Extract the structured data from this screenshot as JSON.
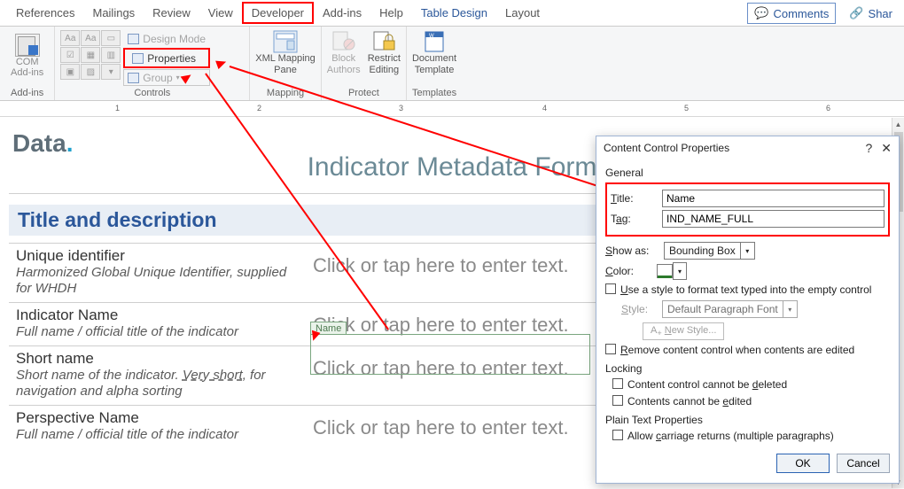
{
  "tabs": {
    "references": "References",
    "mailings": "Mailings",
    "review": "Review",
    "view": "View",
    "developer": "Developer",
    "addins": "Add-ins",
    "help": "Help",
    "tabledesign": "Table Design",
    "layout": "Layout"
  },
  "top": {
    "comments": "Comments",
    "share": "Shar"
  },
  "groups": {
    "addins": {
      "com1": "COM",
      "com2": "Add-ins",
      "label": "Add-ins"
    },
    "controls": {
      "design": "Design Mode",
      "props": "Properties",
      "group": "Group",
      "label": "Controls"
    },
    "mapping": {
      "l1": "XML Mapping",
      "l2": "Pane",
      "label": "Mapping"
    },
    "protect": {
      "b1a": "Block",
      "b1b": "Authors",
      "b2a": "Restrict",
      "b2b": "Editing",
      "label": "Protect"
    },
    "templates": {
      "l1": "Document",
      "l2": "Template",
      "label": "Templates"
    }
  },
  "ruler": {
    "v1": "1",
    "v2": "2",
    "v3": "3",
    "v4": "4",
    "v5": "5",
    "v6": "6"
  },
  "doc": {
    "logo": "Data",
    "title": "Indicator Metadata Form",
    "section": "Title and description",
    "placeholder": "Click or tap here to enter text.",
    "nametag": "Name",
    "rows": {
      "r0": {
        "label": "Unique identifier",
        "desc": "Harmonized Global Unique Identifier, supplied for WHDH"
      },
      "r1": {
        "label": "Indicator Name",
        "desc": "Full name / official title of the indicator"
      },
      "r2": {
        "label": "Short name",
        "desc1": "Short name of the indicator. ",
        "desc_u": "Very short",
        "desc2": ", for navigation and alpha sorting"
      },
      "r3": {
        "label": "Perspective Name",
        "desc": "Full name / official title of the indicator"
      }
    }
  },
  "dialog": {
    "title": "Content Control Properties",
    "general": "General",
    "titlelabel": "Title:",
    "titleval": "Name",
    "taglabel": "Tag:",
    "tagval": "IND_NAME_FULL",
    "showas": "Show as:",
    "showas_v": "Bounding Box",
    "color": "Color:",
    "usestyle": "Use a style to format text typed into the empty control",
    "style": "Style:",
    "style_v": "Default Paragraph Font",
    "newstyle": "New Style...",
    "remove": "Remove content control when contents are edited",
    "locking": "Locking",
    "lock1": "Content control cannot be deleted",
    "lock2": "Contents cannot be edited",
    "ptp": "Plain Text Properties",
    "allow": "Allow carriage returns (multiple paragraphs)",
    "ok": "OK",
    "cancel": "Cancel"
  }
}
